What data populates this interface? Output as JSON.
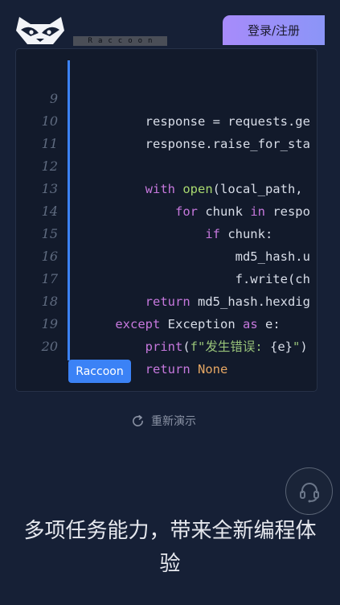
{
  "header": {
    "brand_tag": "Raccoon",
    "login_label": "登录/注册"
  },
  "code": {
    "lines": [
      {
        "num": "9",
        "text": "        response = requests.ge"
      },
      {
        "num": "10",
        "text": "        response.raise_for_sta"
      },
      {
        "num": "11",
        "text": ""
      },
      {
        "num": "12",
        "text": "        with open(local_path,"
      },
      {
        "num": "13",
        "text": "            for chunk in respo"
      },
      {
        "num": "14",
        "text": "                if chunk:"
      },
      {
        "num": "15",
        "text": "                    md5_hash.u"
      },
      {
        "num": "16",
        "text": "                    f.write(ch"
      },
      {
        "num": "17",
        "text": "        return md5_hash.hexdig"
      },
      {
        "num": "18",
        "text": "    except Exception as e:"
      },
      {
        "num": "19",
        "text": "        print(f\"发生错误: {e}\")"
      },
      {
        "num": "20",
        "text": "        return None"
      }
    ],
    "badge": "Raccoon"
  },
  "replay_label": "重新演示",
  "headline": "多项任务能力，带来全新编程体验",
  "colors": {
    "background": "#162036",
    "accent": "#3b82f6",
    "login_gradient_start": "#a78bfa",
    "login_gradient_end": "#8b95f7"
  },
  "icons": {
    "logo": "raccoon-logo-icon",
    "replay": "refresh-icon",
    "support": "headset-icon"
  }
}
